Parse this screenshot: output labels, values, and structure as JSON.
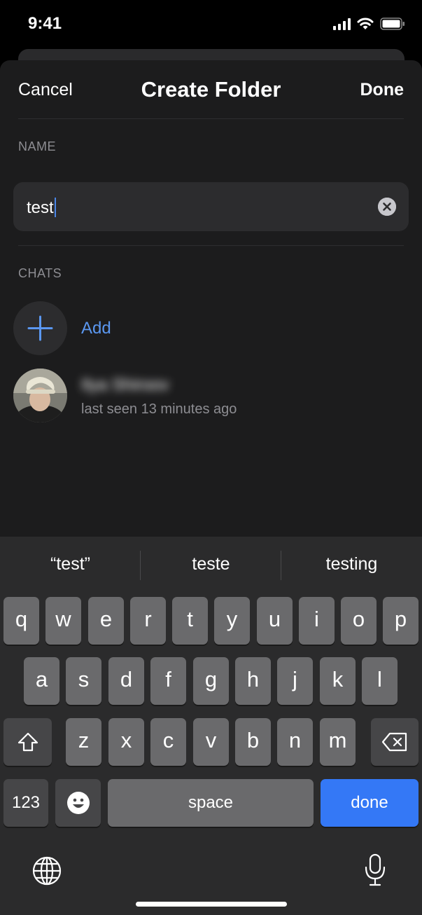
{
  "status": {
    "time": "9:41"
  },
  "nav": {
    "cancel": "Cancel",
    "title": "Create Folder",
    "done": "Done"
  },
  "name_section": {
    "label": "NAME",
    "value": "test"
  },
  "chats_section": {
    "label": "CHATS",
    "add_label": "Add",
    "chats": [
      {
        "name": "Ilya Shiroov",
        "status": "last seen 13 minutes ago"
      }
    ]
  },
  "keyboard": {
    "suggestions": [
      "“test”",
      "teste",
      "testing"
    ],
    "row1": [
      "q",
      "w",
      "e",
      "r",
      "t",
      "y",
      "u",
      "i",
      "o",
      "p"
    ],
    "row2": [
      "a",
      "s",
      "d",
      "f",
      "g",
      "h",
      "j",
      "k",
      "l"
    ],
    "row3": [
      "z",
      "x",
      "c",
      "v",
      "b",
      "n",
      "m"
    ],
    "numbers_key": "123",
    "space_key": "space",
    "return_key": "done"
  },
  "colors": {
    "accent": "#5b97f0",
    "return_key": "#3478f6",
    "sheet_bg": "#1c1c1d",
    "field_bg": "#2c2c2e"
  },
  "icons": [
    "signal-icon",
    "wifi-icon",
    "battery-icon",
    "clear-icon",
    "plus-icon",
    "shift-icon",
    "backspace-icon",
    "emoji-icon",
    "globe-icon",
    "microphone-icon"
  ]
}
